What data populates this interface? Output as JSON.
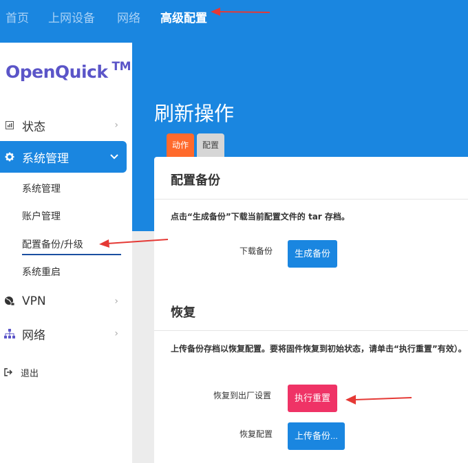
{
  "topnav": {
    "items": [
      "首页",
      "上网设备",
      "网络",
      "高级配置"
    ],
    "active_index": 3
  },
  "sidebar": {
    "logo": "OpenQuick",
    "logo_tm": "TM",
    "status_label": "状态",
    "system_label": "系统管理",
    "sub_items": [
      "系统管理",
      "账户管理",
      "配置备份/升级",
      "系统重启"
    ],
    "vpn_label": "VPN",
    "network_label": "网络",
    "logout_label": "退出"
  },
  "main": {
    "page_title": "刷新操作",
    "tabs": [
      "动作",
      "配置"
    ],
    "backup": {
      "title": "配置备份",
      "description": "点击“生成备份”下载当前配置文件的 tar 存档。",
      "download_label": "下载备份",
      "generate_button": "生成备份"
    },
    "restore": {
      "title": "恢复",
      "description": "上传备份存档以恢复配置。要将固件恢复到初始状态，请单击“执行重置”有效）。",
      "factory_label": "恢复到出厂设置",
      "reset_button": "执行重置",
      "restore_label": "恢复配置",
      "upload_button": "上传备份..."
    }
  },
  "colors": {
    "brand_blue": "#1a86e0",
    "tab_orange": "#ff6a2c",
    "danger_red": "#ef3366",
    "logo_purple": "#5b55c8",
    "annotation_red": "#e53935"
  }
}
